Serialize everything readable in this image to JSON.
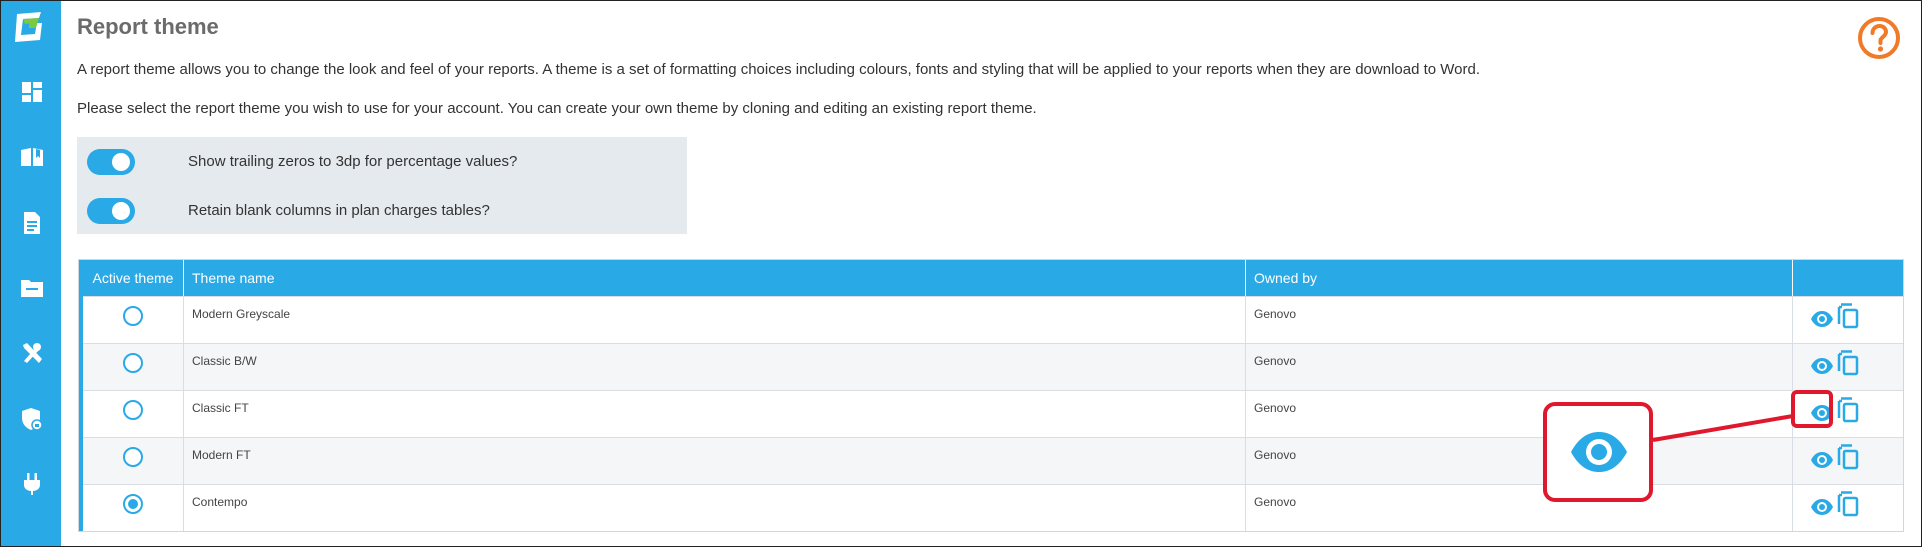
{
  "page": {
    "title": "Report theme",
    "description_1": "A report theme allows you to change the look and feel of your reports. A theme is a set of formatting choices including colours, fonts and styling that will be applied to your reports when they are download to Word.",
    "description_2": "Please select the report theme you wish to use for your account. You can create your own theme by cloning and editing an existing report theme."
  },
  "help_icon": "help-circle-icon",
  "sidebar": {
    "logo": "genovo-logo",
    "items": [
      {
        "icon": "dashboard-icon"
      },
      {
        "icon": "book-icon"
      },
      {
        "icon": "document-icon"
      },
      {
        "icon": "folder-icon"
      },
      {
        "icon": "tools-icon"
      },
      {
        "icon": "shield-lock-icon"
      },
      {
        "icon": "plug-icon"
      }
    ]
  },
  "settings": {
    "toggles": [
      {
        "label": "Show trailing zeros to 3dp for percentage values?",
        "on": true
      },
      {
        "label": "Retain blank columns in plan charges tables?",
        "on": true
      }
    ]
  },
  "table": {
    "headers": {
      "active": "Active theme",
      "name": "Theme name",
      "owner": "Owned by",
      "actions": ""
    },
    "rows": [
      {
        "active": false,
        "name": "Modern Greyscale",
        "owner": "Genovo"
      },
      {
        "active": false,
        "name": "Classic B/W",
        "owner": "Genovo"
      },
      {
        "active": false,
        "name": "Classic FT",
        "owner": "Genovo"
      },
      {
        "active": false,
        "name": "Modern FT",
        "owner": "Genovo"
      },
      {
        "active": true,
        "name": "Contempo",
        "owner": "Genovo"
      }
    ]
  },
  "colors": {
    "accent": "#29a9e6",
    "help": "#f07a27",
    "annotation": "#e0182d",
    "panel": "#e5eaee"
  }
}
